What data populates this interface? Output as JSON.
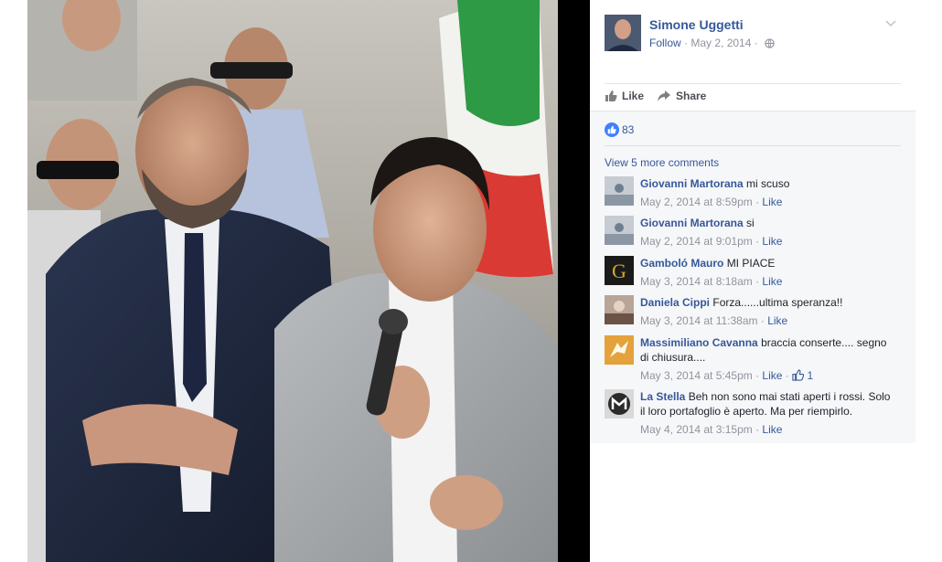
{
  "post": {
    "author": "Simone Uggetti",
    "follow_label": "Follow",
    "separator": " · ",
    "date": "May 2, 2014",
    "like_label": "Like",
    "share_label": "Share",
    "reaction_count": "83",
    "view_more": "View 5 more comments"
  },
  "comments": [
    {
      "name": "Giovanni Martorana",
      "text": "mi scuso",
      "time": "May 2, 2014 at 8:59pm",
      "like": "Like",
      "likes": ""
    },
    {
      "name": "Giovanni Martorana",
      "text": "si",
      "time": "May 2, 2014 at 9:01pm",
      "like": "Like",
      "likes": ""
    },
    {
      "name": "Gamboló Mauro",
      "text": "MI PIACE",
      "time": "May 3, 2014 at 8:18am",
      "like": "Like",
      "likes": ""
    },
    {
      "name": "Daniela Cippi",
      "text": "Forza......ultima speranza!!",
      "time": "May 3, 2014 at 11:38am",
      "like": "Like",
      "likes": ""
    },
    {
      "name": "Massimiliano Cavanna",
      "text": "braccia conserte.... segno di chiusura....",
      "time": "May 3, 2014 at 5:45pm",
      "like": "Like",
      "likes": "1"
    },
    {
      "name": "La Stella",
      "text": "Beh non sono mai stati aperti i rossi. Solo il loro portafoglio è aperto. Ma per riempirlo.",
      "time": "May 4, 2014 at 3:15pm",
      "like": "Like",
      "likes": ""
    }
  ],
  "avatar_letter": "G",
  "colors": {
    "link": "#365899",
    "meta": "#90949c",
    "like_blue": "#4080ff"
  }
}
